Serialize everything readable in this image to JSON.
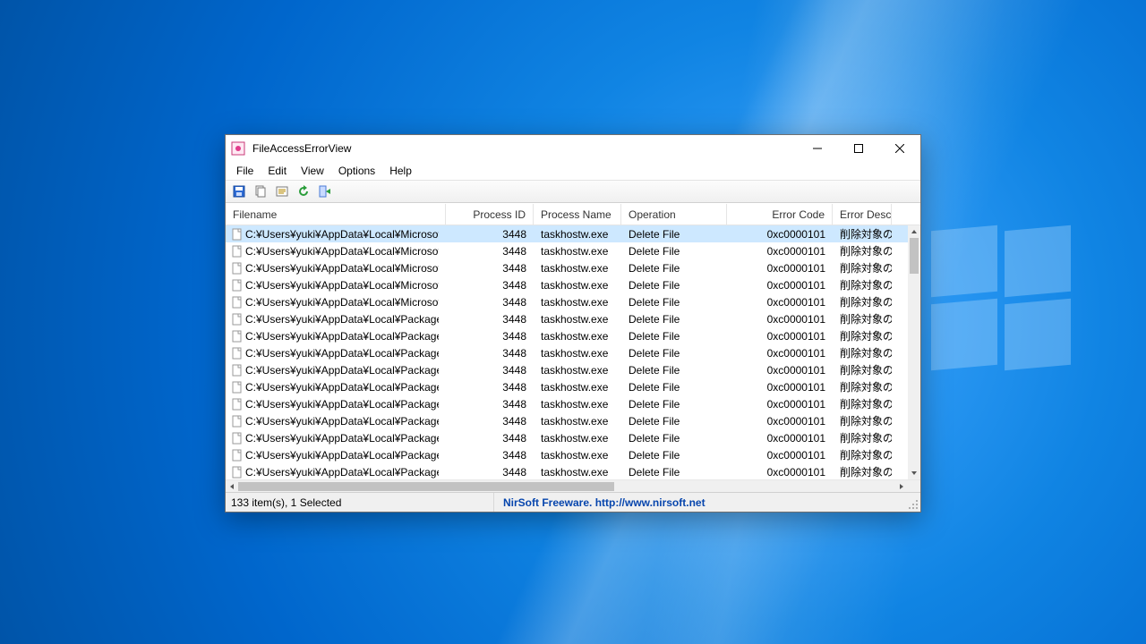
{
  "window": {
    "title": "FileAccessErrorView"
  },
  "menubar": {
    "file": "File",
    "edit": "Edit",
    "view": "View",
    "options": "Options",
    "help": "Help"
  },
  "columns": {
    "filename": "Filename",
    "pid": "Process ID",
    "pname": "Process Name",
    "operation": "Operation",
    "errcode": "Error Code",
    "errdesc": "Error Descrip"
  },
  "rows": [
    {
      "filename": "C:¥Users¥yuki¥AppData¥Local¥Microsoft...",
      "pid": "3448",
      "pname": "taskhostw.exe",
      "operation": "Delete File",
      "errcode": "0xc0000101",
      "errdesc": "削除対象のデ"
    },
    {
      "filename": "C:¥Users¥yuki¥AppData¥Local¥Microsoft...",
      "pid": "3448",
      "pname": "taskhostw.exe",
      "operation": "Delete File",
      "errcode": "0xc0000101",
      "errdesc": "削除対象のデ"
    },
    {
      "filename": "C:¥Users¥yuki¥AppData¥Local¥Microsoft...",
      "pid": "3448",
      "pname": "taskhostw.exe",
      "operation": "Delete File",
      "errcode": "0xc0000101",
      "errdesc": "削除対象のデ"
    },
    {
      "filename": "C:¥Users¥yuki¥AppData¥Local¥Microsoft...",
      "pid": "3448",
      "pname": "taskhostw.exe",
      "operation": "Delete File",
      "errcode": "0xc0000101",
      "errdesc": "削除対象のデ"
    },
    {
      "filename": "C:¥Users¥yuki¥AppData¥Local¥Microsoft...",
      "pid": "3448",
      "pname": "taskhostw.exe",
      "operation": "Delete File",
      "errcode": "0xc0000101",
      "errdesc": "削除対象のデ"
    },
    {
      "filename": "C:¥Users¥yuki¥AppData¥Local¥Packages...",
      "pid": "3448",
      "pname": "taskhostw.exe",
      "operation": "Delete File",
      "errcode": "0xc0000101",
      "errdesc": "削除対象のデ"
    },
    {
      "filename": "C:¥Users¥yuki¥AppData¥Local¥Packages...",
      "pid": "3448",
      "pname": "taskhostw.exe",
      "operation": "Delete File",
      "errcode": "0xc0000101",
      "errdesc": "削除対象のデ"
    },
    {
      "filename": "C:¥Users¥yuki¥AppData¥Local¥Packages...",
      "pid": "3448",
      "pname": "taskhostw.exe",
      "operation": "Delete File",
      "errcode": "0xc0000101",
      "errdesc": "削除対象のデ"
    },
    {
      "filename": "C:¥Users¥yuki¥AppData¥Local¥Packages...",
      "pid": "3448",
      "pname": "taskhostw.exe",
      "operation": "Delete File",
      "errcode": "0xc0000101",
      "errdesc": "削除対象のデ"
    },
    {
      "filename": "C:¥Users¥yuki¥AppData¥Local¥Packages...",
      "pid": "3448",
      "pname": "taskhostw.exe",
      "operation": "Delete File",
      "errcode": "0xc0000101",
      "errdesc": "削除対象のデ"
    },
    {
      "filename": "C:¥Users¥yuki¥AppData¥Local¥Packages...",
      "pid": "3448",
      "pname": "taskhostw.exe",
      "operation": "Delete File",
      "errcode": "0xc0000101",
      "errdesc": "削除対象のデ"
    },
    {
      "filename": "C:¥Users¥yuki¥AppData¥Local¥Packages...",
      "pid": "3448",
      "pname": "taskhostw.exe",
      "operation": "Delete File",
      "errcode": "0xc0000101",
      "errdesc": "削除対象のデ"
    },
    {
      "filename": "C:¥Users¥yuki¥AppData¥Local¥Packages...",
      "pid": "3448",
      "pname": "taskhostw.exe",
      "operation": "Delete File",
      "errcode": "0xc0000101",
      "errdesc": "削除対象のデ"
    },
    {
      "filename": "C:¥Users¥yuki¥AppData¥Local¥Packages...",
      "pid": "3448",
      "pname": "taskhostw.exe",
      "operation": "Delete File",
      "errcode": "0xc0000101",
      "errdesc": "削除対象のデ"
    },
    {
      "filename": "C:¥Users¥yuki¥AppData¥Local¥Packages...",
      "pid": "3448",
      "pname": "taskhostw.exe",
      "operation": "Delete File",
      "errcode": "0xc0000101",
      "errdesc": "削除対象のデ"
    }
  ],
  "status": {
    "counts": "133 item(s), 1 Selected",
    "credit": "NirSoft Freeware.  http://www.nirsoft.net"
  }
}
